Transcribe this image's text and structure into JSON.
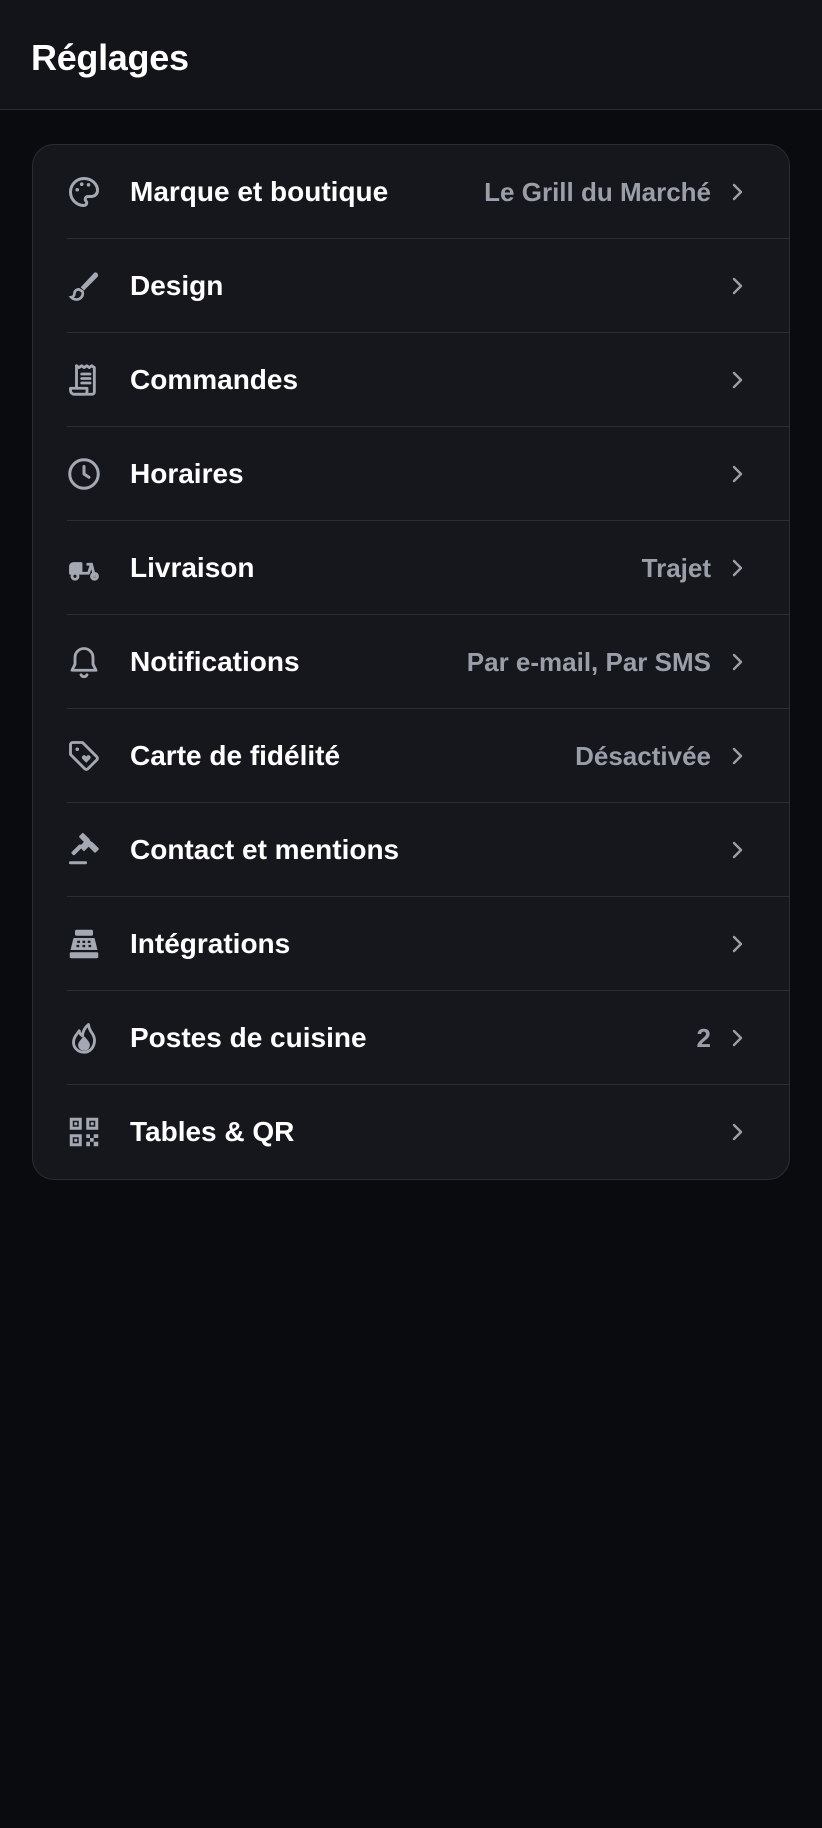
{
  "header": {
    "title": "Réglages"
  },
  "settings": {
    "items": [
      {
        "label": "Marque et boutique",
        "value": "Le Grill du Marché",
        "icon": "palette-icon"
      },
      {
        "label": "Design",
        "value": "",
        "icon": "brush-icon"
      },
      {
        "label": "Commandes",
        "value": "",
        "icon": "receipt-icon"
      },
      {
        "label": "Horaires",
        "value": "",
        "icon": "clock-icon"
      },
      {
        "label": "Livraison",
        "value": "Trajet",
        "icon": "scooter-icon"
      },
      {
        "label": "Notifications",
        "value": "Par e-mail, Par SMS",
        "icon": "bell-icon"
      },
      {
        "label": "Carte de fidélité",
        "value": "Désactivée",
        "icon": "tag-heart-icon"
      },
      {
        "label": "Contact et mentions",
        "value": "",
        "icon": "gavel-icon"
      },
      {
        "label": "Intégrations",
        "value": "",
        "icon": "cash-register-icon"
      },
      {
        "label": "Postes de cuisine",
        "value": "2",
        "icon": "flame-icon"
      },
      {
        "label": "Tables & QR",
        "value": "",
        "icon": "qr-code-icon"
      }
    ]
  },
  "colors": {
    "background": "#0a0b0e",
    "header_bg": "#131419",
    "card_bg": "#16171c",
    "divider": "#2b2d34",
    "text_primary": "#ffffff",
    "text_secondary": "#9a9ea8",
    "icon": "#a4a8b3"
  }
}
